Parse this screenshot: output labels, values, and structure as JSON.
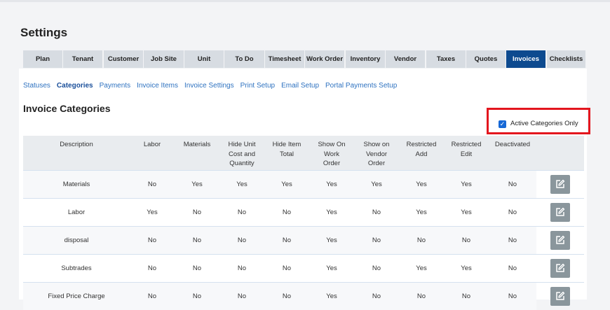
{
  "page": {
    "title": "Settings"
  },
  "tabs": [
    {
      "label": "Plan",
      "active": false
    },
    {
      "label": "Tenant",
      "active": false
    },
    {
      "label": "Customer",
      "active": false
    },
    {
      "label": "Job Site",
      "active": false
    },
    {
      "label": "Unit",
      "active": false
    },
    {
      "label": "To Do",
      "active": false
    },
    {
      "label": "Timesheet",
      "active": false
    },
    {
      "label": "Work Order",
      "active": false
    },
    {
      "label": "Inventory",
      "active": false
    },
    {
      "label": "Vendor",
      "active": false
    },
    {
      "label": "Taxes",
      "active": false
    },
    {
      "label": "Quotes",
      "active": false
    },
    {
      "label": "Invoices",
      "active": true
    },
    {
      "label": "Checklists",
      "active": false
    }
  ],
  "subnav": [
    {
      "label": "Statuses",
      "active": false
    },
    {
      "label": "Categories",
      "active": true
    },
    {
      "label": "Payments",
      "active": false
    },
    {
      "label": "Invoice Items",
      "active": false
    },
    {
      "label": "Invoice Settings",
      "active": false
    },
    {
      "label": "Print Setup",
      "active": false
    },
    {
      "label": "Email Setup",
      "active": false
    },
    {
      "label": "Portal Payments Setup",
      "active": false
    }
  ],
  "section": {
    "title": "Invoice Categories"
  },
  "filter": {
    "label": "Active Categories Only",
    "checked": true
  },
  "table": {
    "columns": [
      "Description",
      "Labor",
      "Materials",
      "Hide Unit Cost and Quantity",
      "Hide Item Total",
      "Show On Work Order",
      "Show on Vendor Order",
      "Restricted Add",
      "Restricted Edit",
      "Deactivated",
      ""
    ],
    "column_display_lines": [
      [
        "Description"
      ],
      [
        "Labor"
      ],
      [
        "Materials"
      ],
      [
        "Hide Unit",
        "Cost and",
        "Quantity"
      ],
      [
        "Hide Item",
        "Total"
      ],
      [
        "Show On",
        "Work",
        "Order"
      ],
      [
        "Show on",
        "Vendor",
        "Order"
      ],
      [
        "Restricted",
        "Add"
      ],
      [
        "Restricted",
        "Edit"
      ],
      [
        "Deactivated"
      ],
      [
        ""
      ]
    ],
    "rows": [
      [
        "Materials",
        "No",
        "Yes",
        "Yes",
        "Yes",
        "Yes",
        "Yes",
        "Yes",
        "Yes",
        "No"
      ],
      [
        "Labor",
        "Yes",
        "No",
        "No",
        "No",
        "Yes",
        "No",
        "Yes",
        "Yes",
        "No"
      ],
      [
        "disposal",
        "No",
        "No",
        "No",
        "No",
        "Yes",
        "No",
        "No",
        "No",
        "No"
      ],
      [
        "Subtrades",
        "No",
        "No",
        "No",
        "No",
        "Yes",
        "No",
        "Yes",
        "Yes",
        "No"
      ],
      [
        "Fixed Price Charge",
        "No",
        "No",
        "No",
        "No",
        "Yes",
        "No",
        "No",
        "No",
        "No"
      ]
    ]
  },
  "icons": {
    "edit": "pencil-square-icon",
    "checkbox": "checkmark-icon"
  },
  "colors": {
    "accent": "#0d4a8f",
    "link": "#2e72c0",
    "highlight": "#e3161e",
    "edit_button": "#8a969c",
    "checkbox": "#1668d6"
  }
}
